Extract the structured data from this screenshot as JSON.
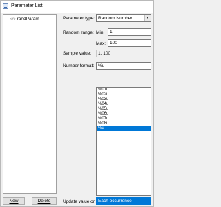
{
  "window": {
    "title": "Parameter List"
  },
  "tree": {
    "items": [
      {
        "label": "randParam"
      }
    ]
  },
  "buttons": {
    "new_label": "New",
    "delete_label": "Delete"
  },
  "form": {
    "parameter_type_label": "Parameter type:",
    "parameter_type_value": "Random Number",
    "random_range_label": "Random range:",
    "min_label": "Min:",
    "min_value": "1",
    "max_label": "Max:",
    "max_value": "100",
    "sample_value_label": "Sample value:",
    "sample_value": "1, 100",
    "number_format_label": "Number format:",
    "number_format_value": "%u",
    "number_format_options": [
      "%01u",
      "%02u",
      "%03u",
      "%04u",
      "%05u",
      "%06u",
      "%07u",
      "%08u",
      "%u"
    ],
    "number_format_selected_index": 8,
    "update_value_label": "Update value on:",
    "update_value_value": "Each occurrence"
  }
}
